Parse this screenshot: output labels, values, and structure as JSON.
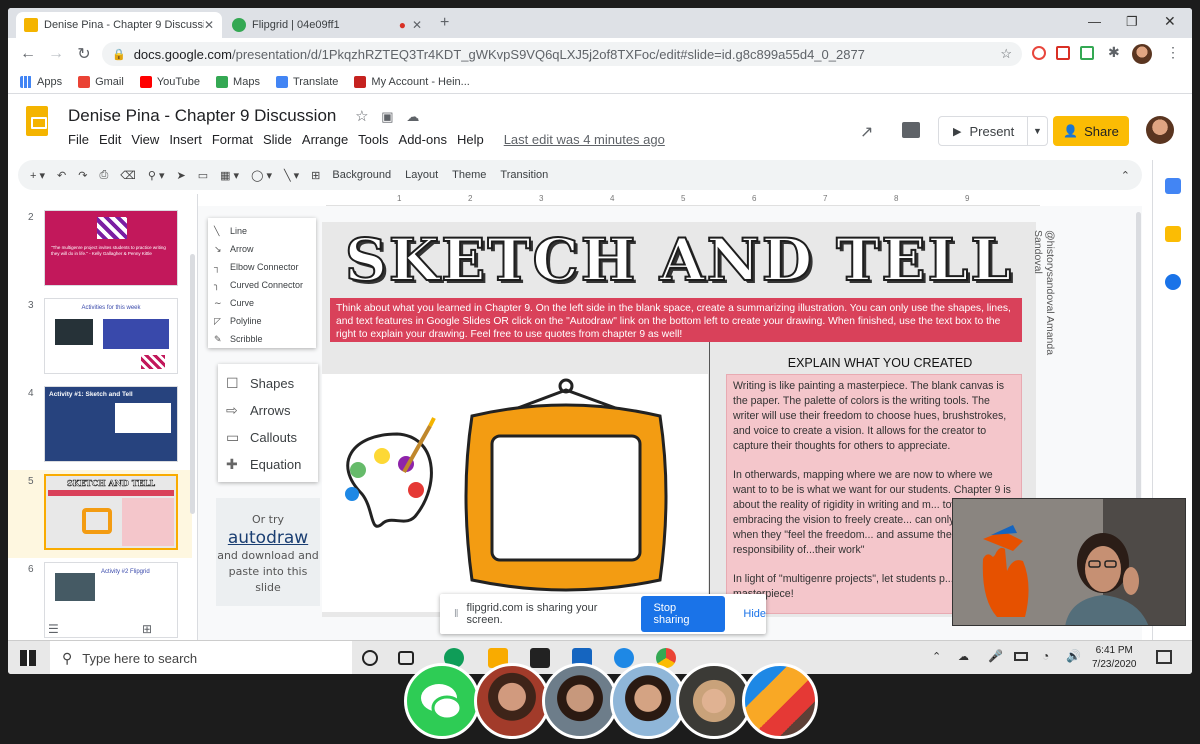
{
  "browser": {
    "tabs": [
      {
        "title": "Denise Pina - Chapter 9 Discussic",
        "color": "#f4b400"
      },
      {
        "title": "Flipgrid | 04e09ff1",
        "color": "#34a853"
      }
    ],
    "new_tab": "+",
    "url_host": "docs.google.com",
    "url_path": "/presentation/d/1PkqzhRZTEQ3Tr4KDT_gWKvpS9VQ6qLXJ5j2of8TXFoc/edit#slide=id.g8c899a55d4_0_2877",
    "bookmarks": [
      "Apps",
      "Gmail",
      "YouTube",
      "Maps",
      "Translate",
      "My Account - Hein..."
    ]
  },
  "doc": {
    "title": "Denise Pina - Chapter 9 Discussion",
    "menus": [
      "File",
      "Edit",
      "View",
      "Insert",
      "Format",
      "Slide",
      "Arrange",
      "Tools",
      "Add-ons",
      "Help"
    ],
    "last_edit": "Last edit was 4 minutes ago",
    "present": "Present",
    "share": "Share"
  },
  "toolbar": {
    "labels": [
      "Background",
      "Layout",
      "Theme",
      "Transition"
    ]
  },
  "ruler_ticks": [
    "1",
    "2",
    "3",
    "4",
    "5",
    "6",
    "7",
    "8",
    "9"
  ],
  "filmstrip": {
    "slides": [
      {
        "num": "2",
        "caption": "\"The multigenre project invites students to practice writing they will do in life.\" - Kelly Gallagher & Penny Kittle"
      },
      {
        "num": "3",
        "caption": "Activities for this week"
      },
      {
        "num": "4",
        "caption": "Activity #1: Sketch and Tell"
      },
      {
        "num": "5",
        "caption": "SKETCH AND TELL"
      },
      {
        "num": "6",
        "caption": "Activity #2 Flipgrid"
      }
    ]
  },
  "line_menu": [
    "Line",
    "Arrow",
    "Elbow Connector",
    "Curved Connector",
    "Curve",
    "Polyline",
    "Scribble"
  ],
  "shape_menu": [
    "Shapes",
    "Arrows",
    "Callouts",
    "Equation"
  ],
  "autodraw": {
    "pre": "Or try",
    "link": "autodraw",
    "post": "and download and paste into this slide"
  },
  "slide": {
    "title": "SKETCH AND TELL",
    "instructions": "Think about what you learned in Chapter 9.  On the left side in the blank space, create a summarizing illustration.  You can only use the shapes, lines, and text features in Google Slides OR click on the \"Autodraw\" link on the bottom left to create your drawing.  When finished, use the text box to the right to explain your drawing.  Feel free to use quotes from chapter 9 as well!",
    "explain_header": "EXPLAIN WHAT YOU CREATED",
    "explain_p1": "Writing is like painting a masterpiece.  The blank canvas is the paper.  The palette of colors is the writing tools.  The writer will use their freedom to choose hues, brushstrokes, and voice to create a vision.  It allows for the creator to capture their thoughts for others to appreciate.",
    "explain_p2": "In otherwards, mapping where we are now to where we want to to be is what we want for our students.  Chapter 9 is about the reality of rigidity in writing and m... towards embracing the vision to freely create... can only do this when they \"feel the freedom... and assume the responsibility of...their work\"",
    "explain_p3": "In light of \"multigenre projects\", let students p... masterpiece!",
    "credit": "@historysandoval Amanda Sandoval"
  },
  "share_notice": {
    "text": "flipgrid.com is sharing your screen.",
    "stop": "Stop sharing",
    "hide": "Hide"
  },
  "taskbar": {
    "search": "Type here to search",
    "time": "6:41 PM",
    "date": "7/23/2020"
  },
  "participants": [
    "chat-bubble",
    "participant",
    "participant",
    "participant",
    "participant",
    "participant"
  ]
}
